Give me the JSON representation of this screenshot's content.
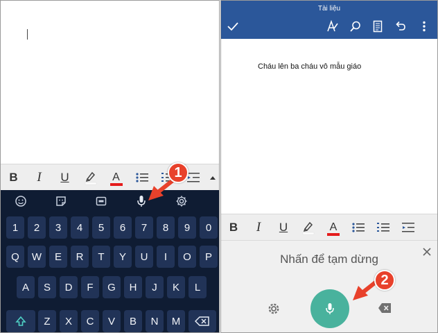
{
  "left_panel": {
    "format_bar": {
      "bold": "B",
      "italic": "I",
      "underline": "U",
      "font_color": "A",
      "icons": [
        "highlighter-icon",
        "bullet-list-icon",
        "numbered-list-icon",
        "indent-icon",
        "expand-up-icon"
      ]
    },
    "keyboard": {
      "toolbar_icons": [
        "emoji-icon",
        "sticker-icon",
        "gif-icon",
        "microphone-icon",
        "gear-icon"
      ],
      "rows": [
        [
          "1",
          "2",
          "3",
          "4",
          "5",
          "6",
          "7",
          "8",
          "9",
          "0"
        ],
        [
          "Q",
          "W",
          "E",
          "R",
          "T",
          "Y",
          "U",
          "I",
          "O",
          "P"
        ],
        [
          "A",
          "S",
          "D",
          "F",
          "G",
          "H",
          "J",
          "K",
          "L"
        ],
        [
          "Z",
          "X",
          "C",
          "V",
          "B",
          "N",
          "M"
        ]
      ],
      "special_keys": [
        "shift-icon",
        "backspace-icon"
      ]
    },
    "annotation_number": "1"
  },
  "right_panel": {
    "app_bar": {
      "title": "Tài liệu",
      "icons": [
        "checkmark-icon",
        "draw-pen-icon",
        "search-icon",
        "document-view-icon",
        "undo-icon",
        "more-vertical-icon"
      ]
    },
    "document_text": "Cháu lên ba cháu vô mẫu giáo",
    "format_bar": {
      "bold": "B",
      "italic": "I",
      "underline": "U",
      "font_color": "A"
    },
    "voice_input": {
      "status": "Nhấn để tạm dừng"
    },
    "annotation_number": "2"
  },
  "colors": {
    "word_blue": "#2b579a",
    "keyboard_bg": "#0f1c33",
    "key_bg": "#213357",
    "mic_green": "#49b29d",
    "annotation_red": "#e8412b",
    "font_color_red": "#e41b1b"
  }
}
